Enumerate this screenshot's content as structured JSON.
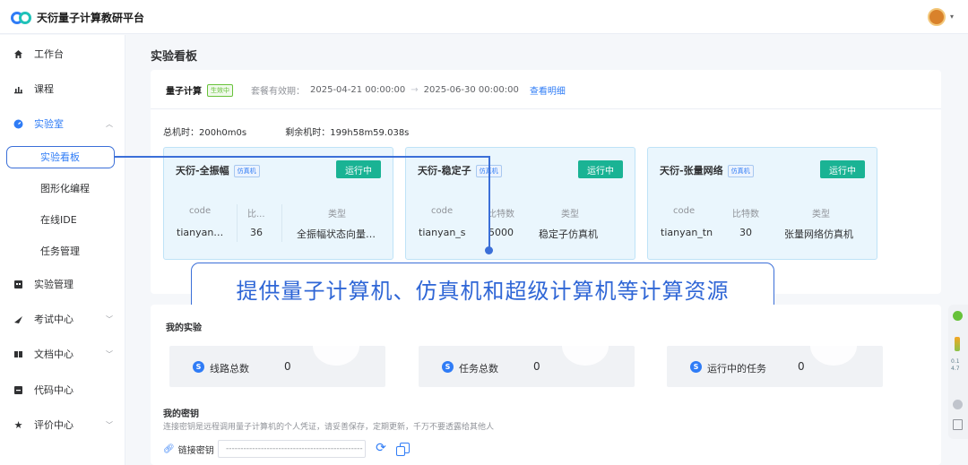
{
  "app": {
    "title": "天衍量子计算教研平台"
  },
  "sidebar": {
    "items": [
      {
        "label": "工作台"
      },
      {
        "label": "课程"
      },
      {
        "label": "实验室"
      },
      {
        "label": "实验看板"
      },
      {
        "label": "图形化编程"
      },
      {
        "label": "在线IDE"
      },
      {
        "label": "任务管理"
      },
      {
        "label": "实验管理"
      },
      {
        "label": "考试中心"
      },
      {
        "label": "文档中心"
      },
      {
        "label": "代码中心"
      },
      {
        "label": "评价中心"
      }
    ]
  },
  "page": {
    "title": "实验看板"
  },
  "package": {
    "name": "量子计算",
    "status": "生效中",
    "validity_label": "套餐有效期：",
    "start": "2025-04-21 00:00:00",
    "arrow": "→",
    "end": "2025-06-30 00:00:00",
    "view_details": "查看明细"
  },
  "time": {
    "total": "总机时：200h0m0s",
    "remaining": "剩余机时：199h58m59.038s"
  },
  "machines": [
    {
      "name": "天衍-全振幅",
      "type": "仿真机",
      "status": "运行中",
      "h_code": "code",
      "h_bits": "比...",
      "h_type": "类型",
      "code": "tianyan…",
      "bits": "36",
      "category": "全振幅状态向量…"
    },
    {
      "name": "天衍-稳定子",
      "type": "仿真机",
      "status": "运行中",
      "h_code": "code",
      "h_bits": "比特数",
      "h_type": "类型",
      "code": "tianyan_s",
      "bits": "5000",
      "category": "稳定子仿真机"
    },
    {
      "name": "天衍-张量网络",
      "type": "仿真机",
      "status": "运行中",
      "h_code": "code",
      "h_bits": "比特数",
      "h_type": "类型",
      "code": "tianyan_tn",
      "bits": "30",
      "category": "张量网络仿真机"
    }
  ],
  "callout": {
    "text": "提供量子计算机、仿真机和超级计算机等计算资源"
  },
  "my_experiments": {
    "title": "我的实验",
    "stats": [
      {
        "label": "线路总数",
        "value": "0"
      },
      {
        "label": "任务总数",
        "value": "0"
      },
      {
        "label": "运行中的任务",
        "value": "0"
      }
    ]
  },
  "my_key": {
    "title": "我的密钥",
    "description": "连接密钥是远程调用量子计算机的个人凭证，请妥善保存，定期更新，千万不要透露给其他人",
    "link_label": "链接密钥",
    "masked_value": "-----------------------------------------------"
  },
  "floating": {
    "line1": "0.1",
    "line2": "4.7"
  }
}
